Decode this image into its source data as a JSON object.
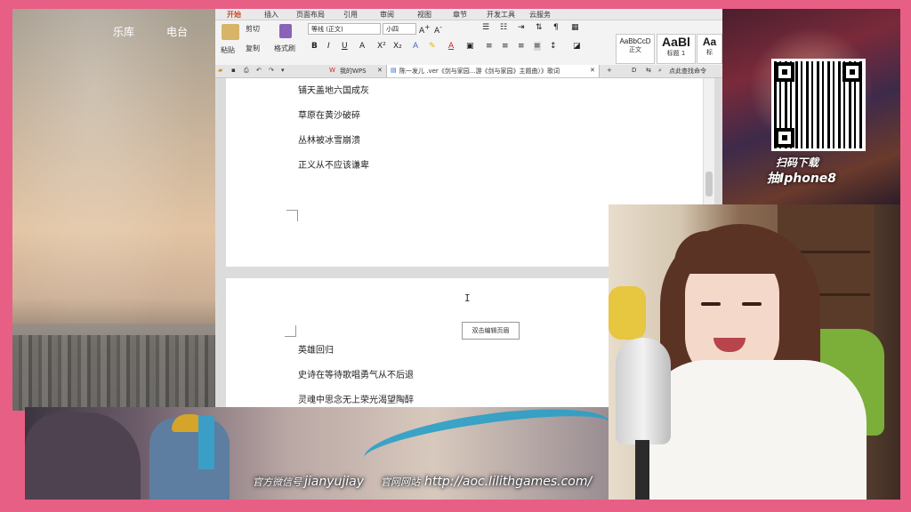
{
  "music_app": {
    "tabs": [
      "乐库",
      "电台"
    ]
  },
  "wps": {
    "ribbon_tabs": [
      "开始",
      "插入",
      "页面布局",
      "引用",
      "审阅",
      "视图",
      "章节",
      "开发工具",
      "云服务"
    ],
    "clipboard": {
      "paste": "粘贴",
      "cut": "剪切",
      "copy": "复制",
      "format_painter": "格式刷"
    },
    "font_name": "等线 (正文)",
    "font_size": "小四",
    "styles": [
      {
        "sample": "AaBbCcD",
        "label": "正文"
      },
      {
        "sample": "AaBl",
        "label": "标题 1"
      },
      {
        "sample": "Aa",
        "label": "标"
      }
    ],
    "tabs": {
      "my_wps": "我的WPS",
      "document": "陈一发儿 .ver《剑与家园...游《剑与家园》主题曲）》歌词",
      "search": "点此查找命令"
    },
    "page1_lines": [
      "铺天盖地六国成灰",
      "草原在黄沙破碎",
      "丛林被冰雪崩溃",
      "正义从不应该谦卑"
    ],
    "tooltip": "双击编辑页眉",
    "page2_lines": [
      "英雄回归",
      "史诗在等待歌唱勇气从不后退",
      "灵魂中思念无上荣光渴望陶醉"
    ]
  },
  "qr_panel": {
    "caption_line1": "扫码下载",
    "caption_line2": "抽Iphone8"
  },
  "banner": {
    "weibo_label": "官方微信号",
    "weibo_handle": "jianyujiay",
    "site_label": "官网网站",
    "site_url": "http://aoc.lilithgames.com/"
  },
  "colors": {
    "frame": "#e85f86",
    "wps_accent": "#d24726",
    "chair": "#7cae3a"
  }
}
